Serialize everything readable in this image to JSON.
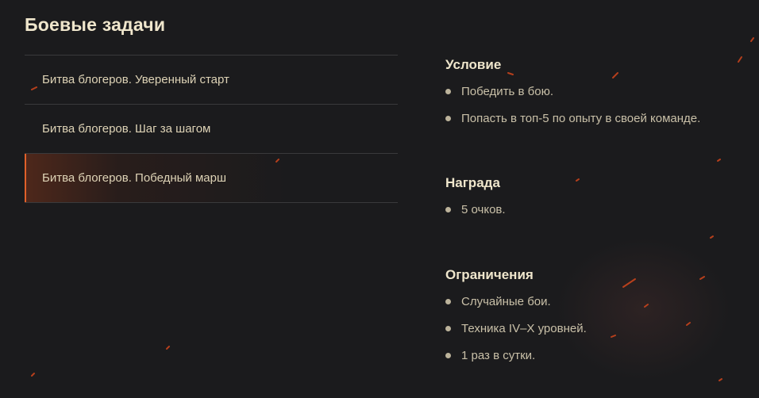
{
  "page": {
    "title": "Боевые задачи"
  },
  "tasks": [
    {
      "label": "Битва блогеров. Уверенный старт",
      "active": false
    },
    {
      "label": "Битва блогеров. Шаг за шагом",
      "active": false
    },
    {
      "label": "Битва блогеров. Победный марш",
      "active": true
    }
  ],
  "details": {
    "condition": {
      "title": "Условие",
      "items": [
        "Победить в бою.",
        "Попасть в топ-5 по опыту в своей команде."
      ]
    },
    "reward": {
      "title": "Награда",
      "items": [
        "5 очков."
      ]
    },
    "restrictions": {
      "title": "Ограничения",
      "items": [
        "Случайные бои.",
        "Техника IV–X уровней.",
        "1 раз в сутки."
      ]
    }
  },
  "colors": {
    "background": "#1b1b1d",
    "accent": "#e0602a",
    "title": "#efe6cc",
    "text": "#c9c0a8"
  }
}
